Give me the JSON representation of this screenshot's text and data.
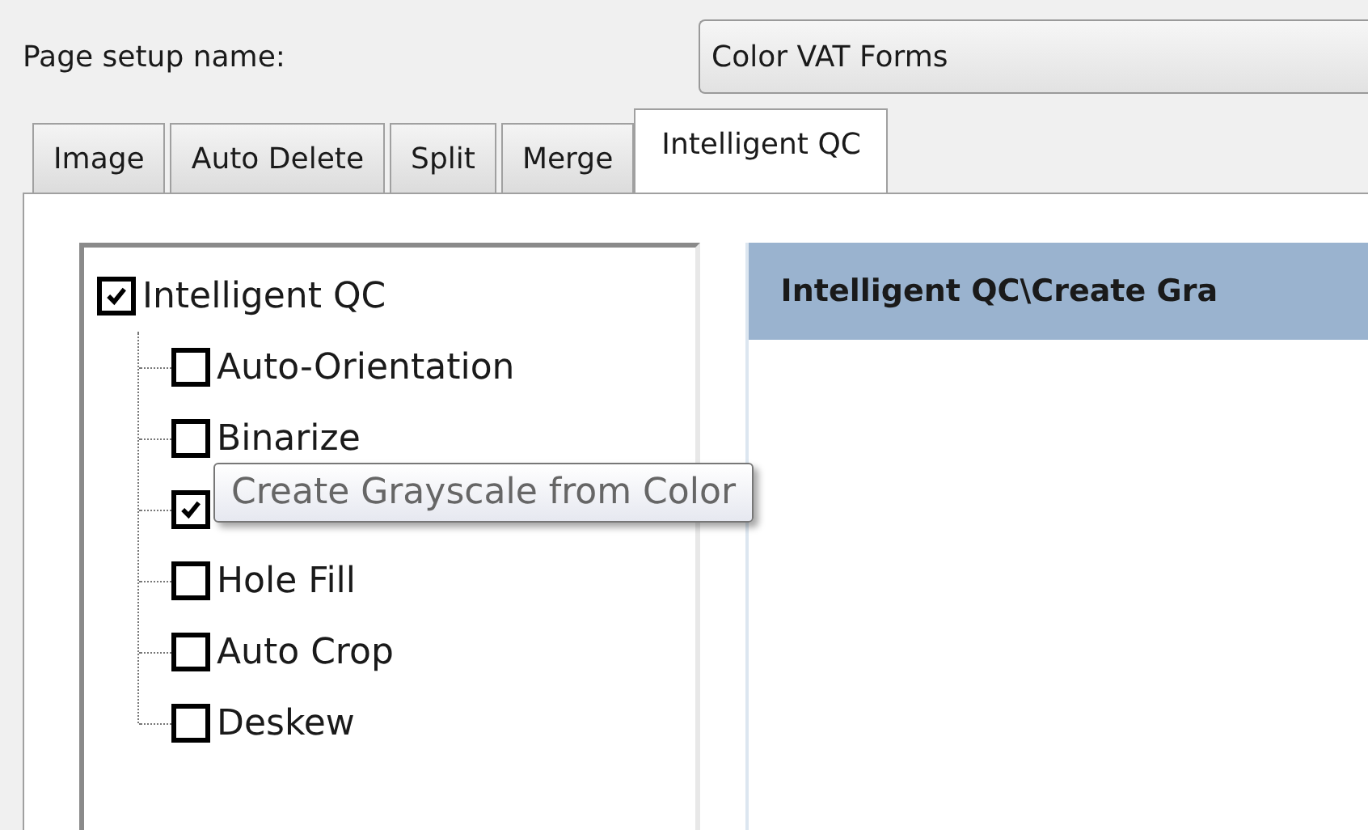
{
  "page_setup": {
    "label": "Page setup name:",
    "value": "Color VAT Forms"
  },
  "tabs": [
    {
      "label": "Image",
      "selected": false
    },
    {
      "label": "Auto Delete",
      "selected": false
    },
    {
      "label": "Split",
      "selected": false
    },
    {
      "label": "Merge",
      "selected": false
    },
    {
      "label": "Intelligent QC",
      "selected": true
    }
  ],
  "tree": {
    "label": "Intelligent QC",
    "checked": true,
    "children": [
      {
        "label": "Auto-Orientation",
        "checked": false
      },
      {
        "label": "Binarize",
        "checked": false
      },
      {
        "checked": true
      },
      {
        "label": "Hole Fill",
        "checked": false
      },
      {
        "label": "Auto Crop",
        "checked": false
      },
      {
        "label": "Deskew",
        "checked": false
      }
    ]
  },
  "detail": {
    "header": "Intelligent QC\\Create Gra"
  },
  "tooltip": "Create Grayscale from Color"
}
